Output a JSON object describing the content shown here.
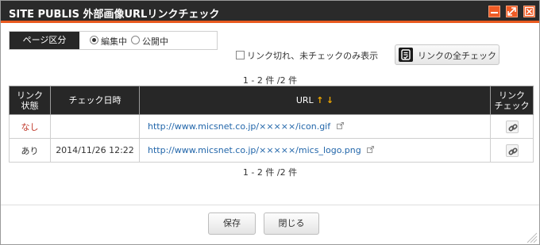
{
  "window": {
    "title": "SITE PUBLIS 外部画像URLリンクチェック",
    "controls": {
      "minimize": "minimize-icon",
      "maximize": "maximize-icon",
      "close": "close-icon"
    },
    "accent_color": "#e8591f"
  },
  "filter": {
    "label": "ページ区分",
    "options": [
      {
        "label": "編集中",
        "selected": true
      },
      {
        "label": "公開中",
        "selected": false
      }
    ]
  },
  "only_unchecked": {
    "label": "リンク切れ、未チェックのみ表示",
    "checked": false
  },
  "check_all_button": {
    "label": "リンクの全チェック",
    "icon": "link-check-all-icon"
  },
  "pagination": {
    "top": "1 - 2 件 /2 件",
    "bottom": "1 - 2 件 /2 件"
  },
  "table": {
    "headers": {
      "status_line1": "リンク",
      "status_line2": "状態",
      "checked_at": "チェック日時",
      "url": "URL",
      "check_line1": "リンク",
      "check_line2": "チェック"
    },
    "sort_arrows": {
      "up": "↑",
      "down": "↓"
    },
    "rows": [
      {
        "status": "なし",
        "checked_at": "",
        "url": "http://www.micsnet.co.jp/×××××/icon.gif"
      },
      {
        "status": "あり",
        "checked_at": "2014/11/26 12:22",
        "url": "http://www.micsnet.co.jp/×××××/mics_logo.png"
      }
    ]
  },
  "footer": {
    "save": "保存",
    "close": "閉じる"
  }
}
